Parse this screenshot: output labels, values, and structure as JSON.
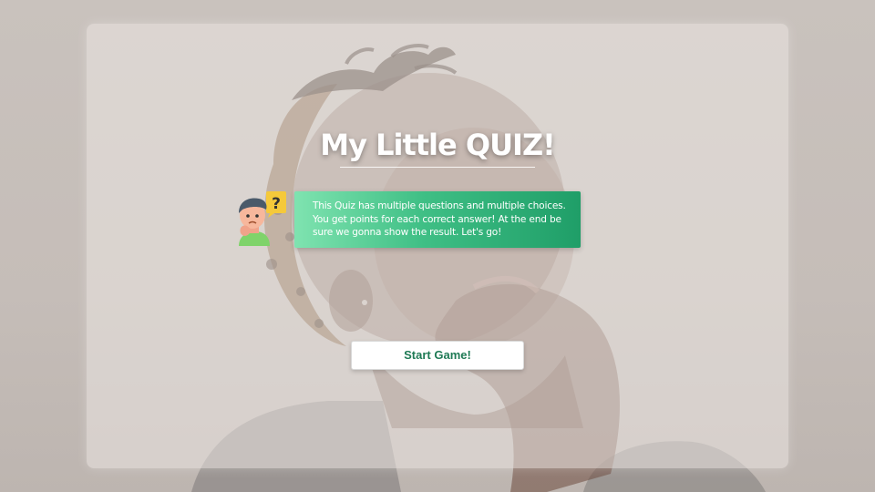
{
  "header": {
    "title": "My Little QUIZ!"
  },
  "intro": {
    "avatar_icon": "thinking-person-icon",
    "text": "This Quiz has multiple questions and multiple choices. You get points for each correct answer! At the end be sure we gonna show the result. Let's go!"
  },
  "actions": {
    "start_label": "Start Game!"
  },
  "colors": {
    "accent": "#1f9e68",
    "accent_light": "#7fe3b0",
    "button_text": "#1f7a55"
  }
}
